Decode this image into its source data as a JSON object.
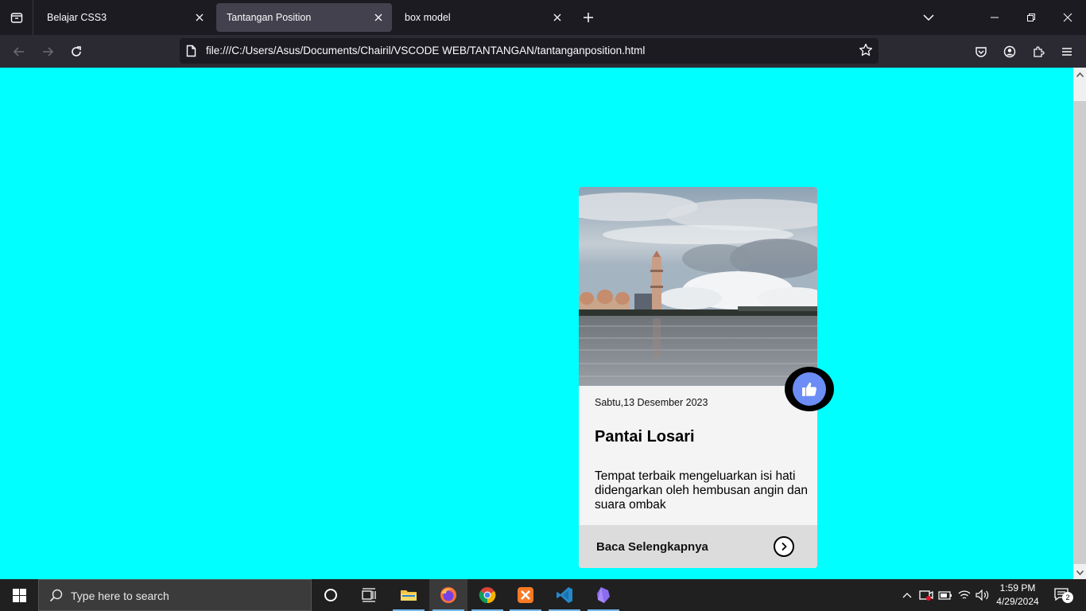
{
  "browser": {
    "tabs": [
      {
        "label": "Belajar CSS3",
        "active": false
      },
      {
        "label": "Tantangan Position",
        "active": true
      },
      {
        "label": "box model",
        "active": false
      }
    ],
    "url": "file:///C:/Users/Asus/Documents/Chairil/VSCODE WEB/TANTANGAN/tantanganposition.html"
  },
  "page": {
    "background_color": "#00ffff",
    "card": {
      "date": "Sabtu,13 Desember 2023",
      "title": "Pantai Losari",
      "description": "Tempat terbaik mengeluarkan isi hati didengarkan oleh hembusan angin dan suara ombak",
      "read_more": "Baca Selengkapnya",
      "like_color": "#6b8df5",
      "footer_color": "#dcdcdc"
    }
  },
  "taskbar": {
    "search_placeholder": "Type here to search",
    "time": "1:59 PM",
    "date": "4/29/2024",
    "notification_count": "2",
    "apps": [
      "task-view",
      "file-explorer",
      "firefox",
      "chrome",
      "xampp",
      "vscode",
      "obsidian"
    ]
  }
}
